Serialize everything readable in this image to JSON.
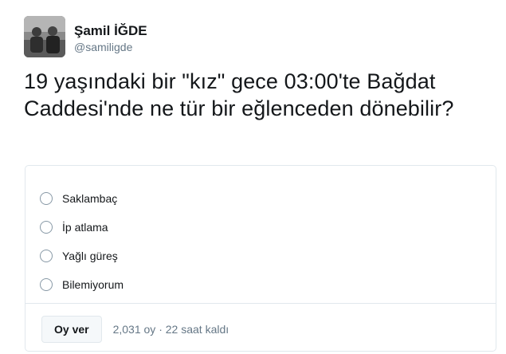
{
  "author": {
    "name": "Şamil İĞDE",
    "handle": "@samiligde"
  },
  "tweet": {
    "text": "19 yaşındaki bir \"kız\" gece 03:00'te Bağdat Caddesi'nde ne tür bir eğlenceden dönebilir?"
  },
  "poll": {
    "options": [
      {
        "label": "Saklambaç"
      },
      {
        "label": "İp atlama"
      },
      {
        "label": "Yağlı güreş"
      },
      {
        "label": "Bilemiyorum"
      }
    ],
    "vote_button_label": "Oy ver",
    "votes": "2,031 oy",
    "separator": "·",
    "time_left": "22 saat kaldı"
  }
}
